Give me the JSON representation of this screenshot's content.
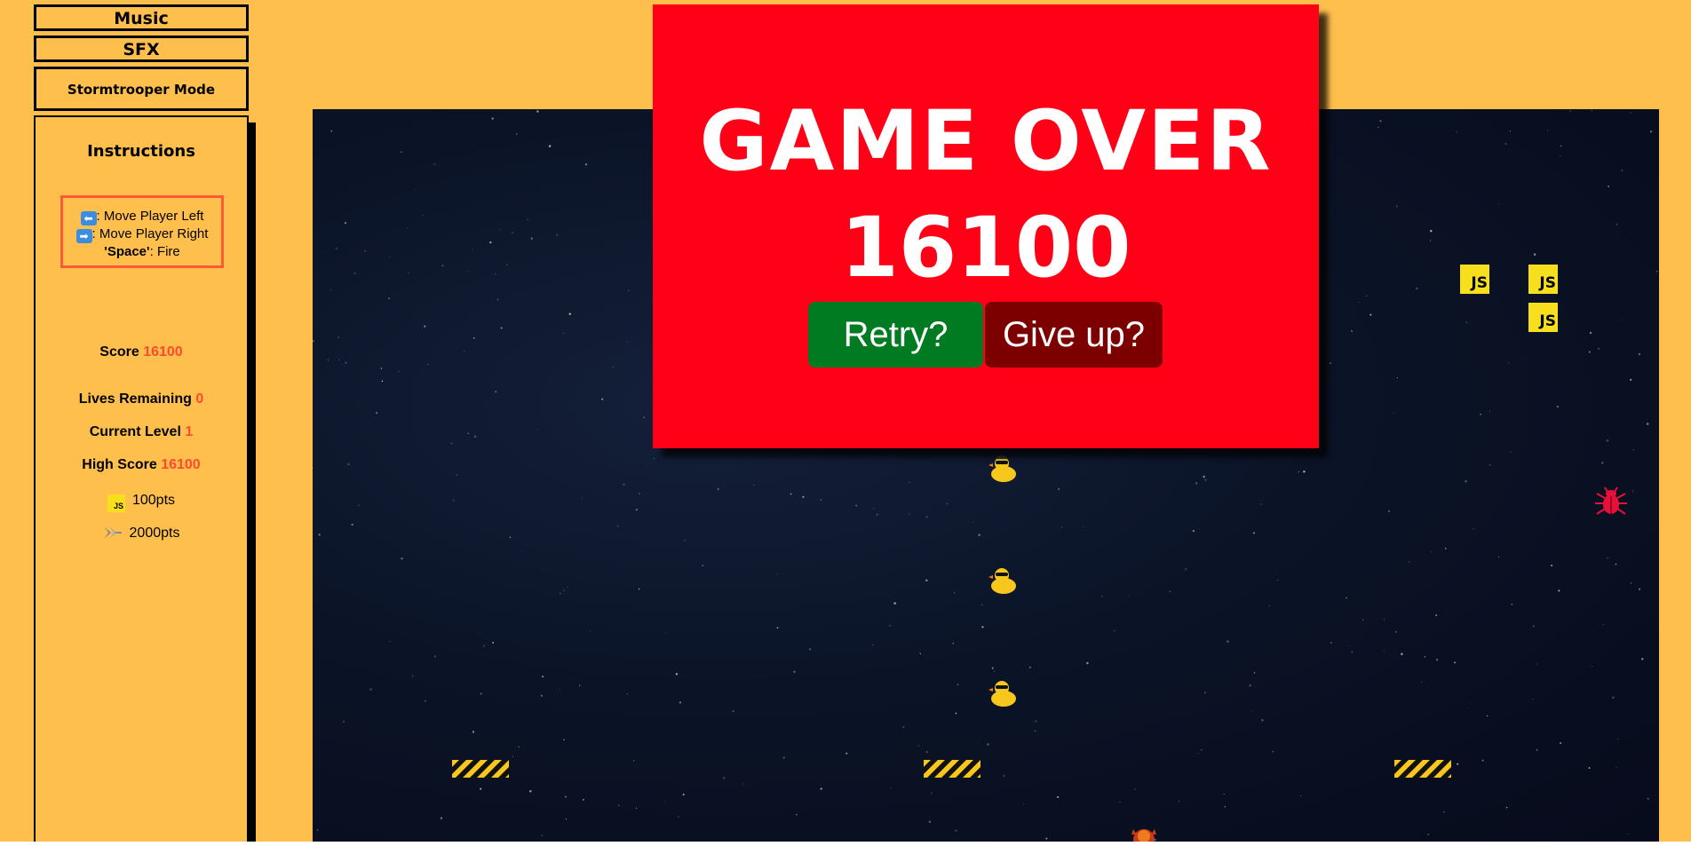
{
  "controls": {
    "music_label": "Music",
    "sfx_label": "SFX",
    "stormtrooper_label": "Stormtrooper Mode"
  },
  "instructions": {
    "title": "Instructions",
    "lines": [
      {
        "key_icon": "left-arrow-key-icon",
        "key": "⬅",
        "text": ": Move Player Left"
      },
      {
        "key_icon": "right-arrow-key-icon",
        "key": "➡",
        "text": ": Move Player Right"
      },
      {
        "key": "'Space'",
        "text": ": Fire"
      }
    ]
  },
  "stats": {
    "score_label": "Score",
    "score_value": "16100",
    "lives_label": "Lives Remaining",
    "lives_value": "0",
    "level_label": "Current Level",
    "level_value": "1",
    "high_label": "High Score",
    "high_value": "16100",
    "js_points": "100pts",
    "ship_points": "2000pts"
  },
  "game": {
    "enemy_label": "JS",
    "enemy_icon": "js-logo-icon",
    "bug_icon": "bug-icon",
    "duck_icon": "rubber-duck-icon",
    "barrier_icon": "hazard-barrier-icon",
    "player_icon": "player-ship-icon"
  },
  "game_over": {
    "title": "GAME OVER",
    "score": "16100",
    "retry_label": "Retry?",
    "give_up_label": "Give up?"
  },
  "colors": {
    "background": "#FFBF4D",
    "accent_value": "#FF4A2E",
    "overlay": "#FF0017",
    "retry": "#007B22",
    "give_up": "#7C0000",
    "js_yellow": "#F7DF1E",
    "bug_red": "#E8103A"
  }
}
